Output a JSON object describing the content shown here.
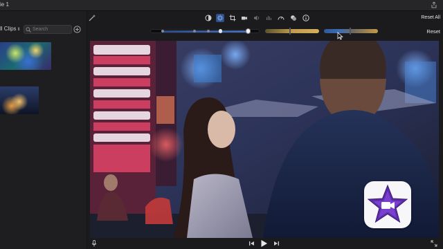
{
  "window": {
    "title": "ie 1"
  },
  "browser": {
    "clip_filter": "ll Clips",
    "search": {
      "placeholder": "Search",
      "value": ""
    }
  },
  "toolbar": {
    "icons": [
      "color-balance-icon",
      "color-correction-icon",
      "crop-icon",
      "stabilization-icon",
      "volume-icon",
      "noise-reduction-icon",
      "speed-icon",
      "clip-filter-icon",
      "info-icon"
    ],
    "active_icon": "color-correction-icon",
    "reset_all_label": "Reset All",
    "reset_label": "Reset"
  },
  "color_correction": {
    "multi_slider": {
      "handles": 5,
      "active": "highlights"
    },
    "saturation": {
      "level": 0.45
    },
    "temperature": {
      "level": 0.48
    }
  },
  "viewer": {
    "description_icon": "imovie-star-icon"
  },
  "playback": {
    "controls": [
      "microphone-icon",
      "skip-back-icon",
      "play-icon",
      "skip-forward-icon",
      "fullscreen-icon"
    ]
  },
  "colors": {
    "accent": "#2d4f86",
    "saturation_gradient": "#bf9d4e",
    "badge_star": "#5b2ca8"
  }
}
